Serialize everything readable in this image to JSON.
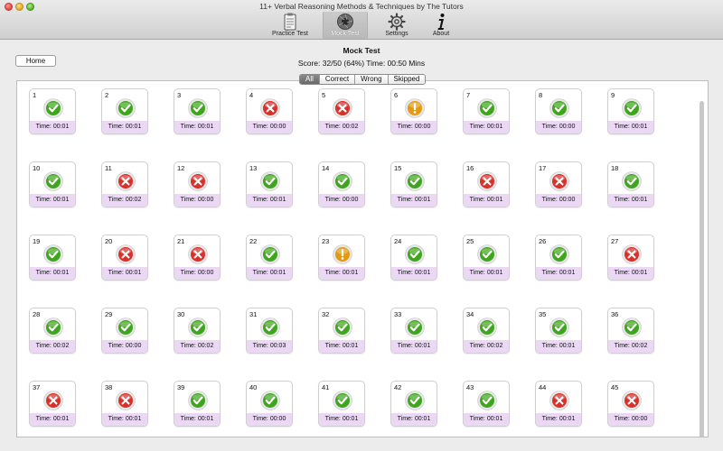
{
  "window": {
    "title": "11+ Verbal Reasoning Methods & Techniques by The Tutors"
  },
  "toolbar": {
    "items": [
      {
        "label": "Practice Test",
        "icon": "clipboard-icon"
      },
      {
        "label": "Mock Test",
        "icon": "camera-aperture-icon"
      },
      {
        "label": "Settings",
        "icon": "gear-icon"
      },
      {
        "label": "About",
        "icon": "info-icon"
      }
    ]
  },
  "home_label": "Home",
  "mock_title": "Mock Test",
  "score_text": "Score: 32/50 (64%) Time: 00:50 Mins",
  "filters": [
    "All",
    "Correct",
    "Wrong",
    "Skipped"
  ],
  "selected_filter": "All",
  "status_colors": {
    "correct": "#3fa51e",
    "wrong": "#d9302a",
    "skipped": "#e29a12"
  },
  "questions": [
    {
      "num": "1",
      "status": "correct",
      "time": "Time: 00:01"
    },
    {
      "num": "2",
      "status": "correct",
      "time": "Time: 00:01"
    },
    {
      "num": "3",
      "status": "correct",
      "time": "Time: 00:01"
    },
    {
      "num": "4",
      "status": "wrong",
      "time": "Time: 00:00"
    },
    {
      "num": "5",
      "status": "wrong",
      "time": "Time: 00:02"
    },
    {
      "num": "6",
      "status": "skipped",
      "time": "Time: 00:00"
    },
    {
      "num": "7",
      "status": "correct",
      "time": "Time: 00:01"
    },
    {
      "num": "8",
      "status": "correct",
      "time": "Time: 00:00"
    },
    {
      "num": "9",
      "status": "correct",
      "time": "Time: 00:01"
    },
    {
      "num": "10",
      "status": "correct",
      "time": "Time: 00:01"
    },
    {
      "num": "11",
      "status": "wrong",
      "time": "Time: 00:02"
    },
    {
      "num": "12",
      "status": "wrong",
      "time": "Time: 00:00"
    },
    {
      "num": "13",
      "status": "correct",
      "time": "Time: 00:01"
    },
    {
      "num": "14",
      "status": "correct",
      "time": "Time: 00:00"
    },
    {
      "num": "15",
      "status": "correct",
      "time": "Time: 00:01"
    },
    {
      "num": "16",
      "status": "wrong",
      "time": "Time: 00:01"
    },
    {
      "num": "17",
      "status": "wrong",
      "time": "Time: 00:00"
    },
    {
      "num": "18",
      "status": "correct",
      "time": "Time: 00:01"
    },
    {
      "num": "19",
      "status": "correct",
      "time": "Time: 00:01"
    },
    {
      "num": "20",
      "status": "wrong",
      "time": "Time: 00:01"
    },
    {
      "num": "21",
      "status": "wrong",
      "time": "Time: 00:00"
    },
    {
      "num": "22",
      "status": "correct",
      "time": "Time: 00:01"
    },
    {
      "num": "23",
      "status": "skipped",
      "time": "Time: 00:01"
    },
    {
      "num": "24",
      "status": "correct",
      "time": "Time: 00:01"
    },
    {
      "num": "25",
      "status": "correct",
      "time": "Time: 00:01"
    },
    {
      "num": "26",
      "status": "correct",
      "time": "Time: 00:01"
    },
    {
      "num": "27",
      "status": "wrong",
      "time": "Time: 00:01"
    },
    {
      "num": "28",
      "status": "correct",
      "time": "Time: 00:02"
    },
    {
      "num": "29",
      "status": "correct",
      "time": "Time: 00:00"
    },
    {
      "num": "30",
      "status": "correct",
      "time": "Time: 00:02"
    },
    {
      "num": "31",
      "status": "correct",
      "time": "Time: 00:03"
    },
    {
      "num": "32",
      "status": "correct",
      "time": "Time: 00:01"
    },
    {
      "num": "33",
      "status": "correct",
      "time": "Time: 00:01"
    },
    {
      "num": "34",
      "status": "correct",
      "time": "Time: 00:02"
    },
    {
      "num": "35",
      "status": "correct",
      "time": "Time: 00:01"
    },
    {
      "num": "36",
      "status": "correct",
      "time": "Time: 00:02"
    },
    {
      "num": "37",
      "status": "wrong",
      "time": "Time: 00:01"
    },
    {
      "num": "38",
      "status": "wrong",
      "time": "Time: 00:01"
    },
    {
      "num": "39",
      "status": "correct",
      "time": "Time: 00:01"
    },
    {
      "num": "40",
      "status": "correct",
      "time": "Time: 00:00"
    },
    {
      "num": "41",
      "status": "correct",
      "time": "Time: 00:01"
    },
    {
      "num": "42",
      "status": "correct",
      "time": "Time: 00:01"
    },
    {
      "num": "43",
      "status": "correct",
      "time": "Time: 00:01"
    },
    {
      "num": "44",
      "status": "wrong",
      "time": "Time: 00:01"
    },
    {
      "num": "45",
      "status": "wrong",
      "time": "Time: 00:00"
    }
  ]
}
